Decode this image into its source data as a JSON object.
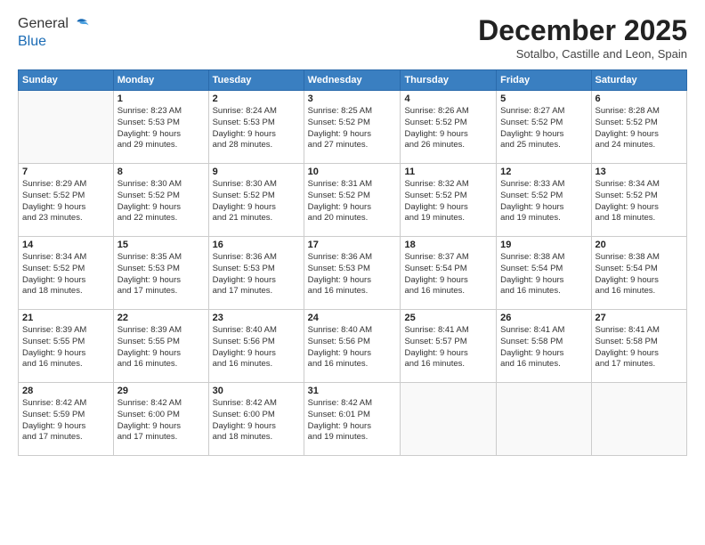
{
  "logo": {
    "line1": "General",
    "line2": "Blue"
  },
  "title": "December 2025",
  "location": "Sotalbo, Castille and Leon, Spain",
  "days_header": [
    "Sunday",
    "Monday",
    "Tuesday",
    "Wednesday",
    "Thursday",
    "Friday",
    "Saturday"
  ],
  "weeks": [
    [
      {
        "day": "",
        "content": ""
      },
      {
        "day": "1",
        "content": "Sunrise: 8:23 AM\nSunset: 5:53 PM\nDaylight: 9 hours\nand 29 minutes."
      },
      {
        "day": "2",
        "content": "Sunrise: 8:24 AM\nSunset: 5:53 PM\nDaylight: 9 hours\nand 28 minutes."
      },
      {
        "day": "3",
        "content": "Sunrise: 8:25 AM\nSunset: 5:52 PM\nDaylight: 9 hours\nand 27 minutes."
      },
      {
        "day": "4",
        "content": "Sunrise: 8:26 AM\nSunset: 5:52 PM\nDaylight: 9 hours\nand 26 minutes."
      },
      {
        "day": "5",
        "content": "Sunrise: 8:27 AM\nSunset: 5:52 PM\nDaylight: 9 hours\nand 25 minutes."
      },
      {
        "day": "6",
        "content": "Sunrise: 8:28 AM\nSunset: 5:52 PM\nDaylight: 9 hours\nand 24 minutes."
      }
    ],
    [
      {
        "day": "7",
        "content": "Sunrise: 8:29 AM\nSunset: 5:52 PM\nDaylight: 9 hours\nand 23 minutes."
      },
      {
        "day": "8",
        "content": "Sunrise: 8:30 AM\nSunset: 5:52 PM\nDaylight: 9 hours\nand 22 minutes."
      },
      {
        "day": "9",
        "content": "Sunrise: 8:30 AM\nSunset: 5:52 PM\nDaylight: 9 hours\nand 21 minutes."
      },
      {
        "day": "10",
        "content": "Sunrise: 8:31 AM\nSunset: 5:52 PM\nDaylight: 9 hours\nand 20 minutes."
      },
      {
        "day": "11",
        "content": "Sunrise: 8:32 AM\nSunset: 5:52 PM\nDaylight: 9 hours\nand 19 minutes."
      },
      {
        "day": "12",
        "content": "Sunrise: 8:33 AM\nSunset: 5:52 PM\nDaylight: 9 hours\nand 19 minutes."
      },
      {
        "day": "13",
        "content": "Sunrise: 8:34 AM\nSunset: 5:52 PM\nDaylight: 9 hours\nand 18 minutes."
      }
    ],
    [
      {
        "day": "14",
        "content": "Sunrise: 8:34 AM\nSunset: 5:52 PM\nDaylight: 9 hours\nand 18 minutes."
      },
      {
        "day": "15",
        "content": "Sunrise: 8:35 AM\nSunset: 5:53 PM\nDaylight: 9 hours\nand 17 minutes."
      },
      {
        "day": "16",
        "content": "Sunrise: 8:36 AM\nSunset: 5:53 PM\nDaylight: 9 hours\nand 17 minutes."
      },
      {
        "day": "17",
        "content": "Sunrise: 8:36 AM\nSunset: 5:53 PM\nDaylight: 9 hours\nand 16 minutes."
      },
      {
        "day": "18",
        "content": "Sunrise: 8:37 AM\nSunset: 5:54 PM\nDaylight: 9 hours\nand 16 minutes."
      },
      {
        "day": "19",
        "content": "Sunrise: 8:38 AM\nSunset: 5:54 PM\nDaylight: 9 hours\nand 16 minutes."
      },
      {
        "day": "20",
        "content": "Sunrise: 8:38 AM\nSunset: 5:54 PM\nDaylight: 9 hours\nand 16 minutes."
      }
    ],
    [
      {
        "day": "21",
        "content": "Sunrise: 8:39 AM\nSunset: 5:55 PM\nDaylight: 9 hours\nand 16 minutes."
      },
      {
        "day": "22",
        "content": "Sunrise: 8:39 AM\nSunset: 5:55 PM\nDaylight: 9 hours\nand 16 minutes."
      },
      {
        "day": "23",
        "content": "Sunrise: 8:40 AM\nSunset: 5:56 PM\nDaylight: 9 hours\nand 16 minutes."
      },
      {
        "day": "24",
        "content": "Sunrise: 8:40 AM\nSunset: 5:56 PM\nDaylight: 9 hours\nand 16 minutes."
      },
      {
        "day": "25",
        "content": "Sunrise: 8:41 AM\nSunset: 5:57 PM\nDaylight: 9 hours\nand 16 minutes."
      },
      {
        "day": "26",
        "content": "Sunrise: 8:41 AM\nSunset: 5:58 PM\nDaylight: 9 hours\nand 16 minutes."
      },
      {
        "day": "27",
        "content": "Sunrise: 8:41 AM\nSunset: 5:58 PM\nDaylight: 9 hours\nand 17 minutes."
      }
    ],
    [
      {
        "day": "28",
        "content": "Sunrise: 8:42 AM\nSunset: 5:59 PM\nDaylight: 9 hours\nand 17 minutes."
      },
      {
        "day": "29",
        "content": "Sunrise: 8:42 AM\nSunset: 6:00 PM\nDaylight: 9 hours\nand 17 minutes."
      },
      {
        "day": "30",
        "content": "Sunrise: 8:42 AM\nSunset: 6:00 PM\nDaylight: 9 hours\nand 18 minutes."
      },
      {
        "day": "31",
        "content": "Sunrise: 8:42 AM\nSunset: 6:01 PM\nDaylight: 9 hours\nand 19 minutes."
      },
      {
        "day": "",
        "content": ""
      },
      {
        "day": "",
        "content": ""
      },
      {
        "day": "",
        "content": ""
      }
    ]
  ]
}
